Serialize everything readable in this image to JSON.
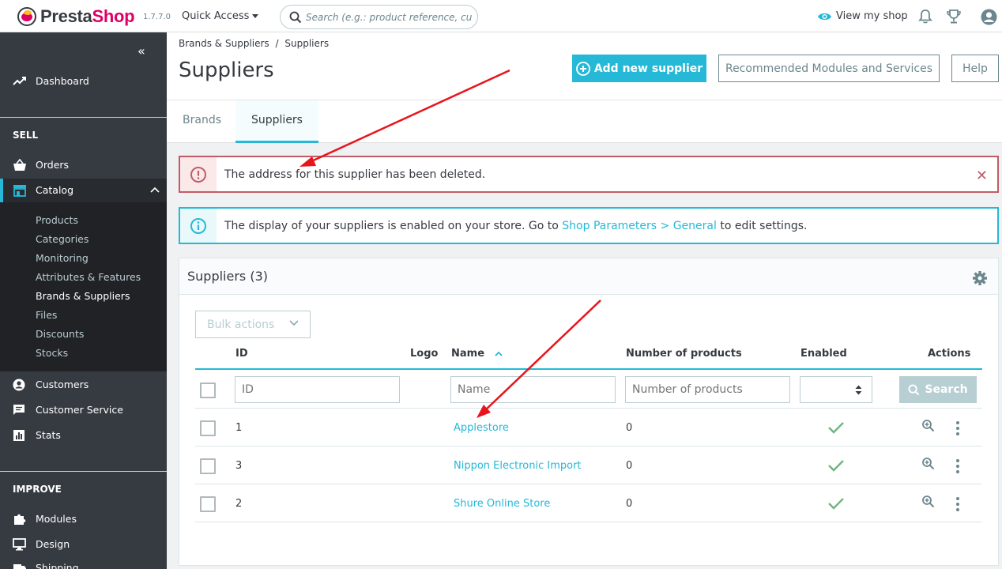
{
  "header": {
    "logo_main": "Presta",
    "logo_accent": "Shop",
    "version": "1.7.7.0",
    "quick_access": "Quick Access",
    "search_placeholder": "Search (e.g.: product reference, customer name…)",
    "view_shop": "View my shop"
  },
  "sidebar": {
    "dashboard": "Dashboard",
    "sell_title": "SELL",
    "orders": "Orders",
    "catalog": "Catalog",
    "catalog_items": [
      "Products",
      "Categories",
      "Monitoring",
      "Attributes & Features",
      "Brands & Suppliers",
      "Files",
      "Discounts",
      "Stocks"
    ],
    "customers": "Customers",
    "customer_service": "Customer Service",
    "stats": "Stats",
    "improve_title": "IMPROVE",
    "modules": "Modules",
    "design": "Design",
    "shipping": "Shipping"
  },
  "toolbar": {
    "breadcrumb_parent": "Brands & Suppliers",
    "breadcrumb_sep": "/",
    "breadcrumb_current": "Suppliers",
    "title": "Suppliers",
    "add_supplier": "Add new supplier",
    "recommended": "Recommended Modules and Services",
    "help": "Help"
  },
  "tabs": [
    "Brands",
    "Suppliers"
  ],
  "alerts": {
    "danger": "The address for this supplier has been deleted.",
    "info_before": "The display of your suppliers is enabled on your store. Go to ",
    "info_link": "Shop Parameters > General",
    "info_after": " to edit settings."
  },
  "grid": {
    "title": "Suppliers (3)",
    "bulk_actions": "Bulk actions",
    "columns": {
      "id": "ID",
      "logo": "Logo",
      "name": "Name",
      "products": "Number of products",
      "enabled": "Enabled",
      "actions": "Actions"
    },
    "filters": {
      "id_placeholder": "ID",
      "name_placeholder": "Name",
      "products_placeholder": "Number of products",
      "search": "Search"
    },
    "rows": [
      {
        "id": "1",
        "name": "Applestore",
        "products": "0",
        "enabled": true
      },
      {
        "id": "3",
        "name": "Nippon Electronic Import",
        "products": "0",
        "enabled": true
      },
      {
        "id": "2",
        "name": "Shure Online Store",
        "products": "0",
        "enabled": true
      }
    ]
  },
  "colors": {
    "accent": "#25b9d7",
    "sidebar_bg": "#363a41",
    "danger": "#c05c67",
    "success": "#70b580",
    "annotation_arrow": "#e8141c"
  }
}
